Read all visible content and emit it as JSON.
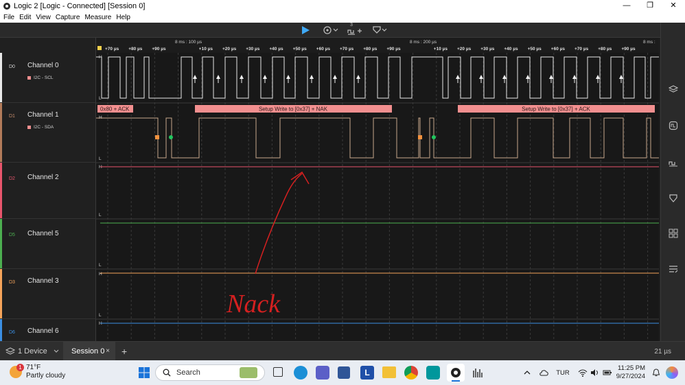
{
  "window": {
    "title": "Logic 2 [Logic - Connected] [Session 0]",
    "minimize": "—",
    "maximize": "❐",
    "close": "✕"
  },
  "menu": [
    "File",
    "Edit",
    "View",
    "Capture",
    "Measure",
    "Help"
  ],
  "toolbar": {
    "play_icon": "play-icon",
    "trigger_icon": "trigger-icon",
    "measure_label": "3",
    "marker_icon": "marker-icon"
  },
  "timeline": {
    "row1": [
      "+70 µs",
      "+80 µs",
      "+90 µs",
      "+10 µs",
      "+20 µs",
      "+30 µs",
      "+40 µs",
      "+50 µs",
      "+60 µs",
      "+70 µs",
      "+80 µs",
      "+90 µs",
      "+10 µs",
      "+20 µs",
      "+30 µs",
      "+40 µs",
      "+50 µs",
      "+60 µs",
      "+70 µs",
      "+80 µs",
      "+90 µs"
    ],
    "markers": [
      "8 ms : 100 µs",
      "8 ms : 200 µs",
      "8 ms :"
    ]
  },
  "channels": [
    {
      "id": "D0",
      "name": "Channel 0",
      "analyzer": "I2C - SCL",
      "color": "#e8e8e8"
    },
    {
      "id": "D1",
      "name": "Channel 1",
      "analyzer": "I2C - SDA",
      "color": "#b27b5a"
    },
    {
      "id": "D2",
      "name": "Channel 2",
      "color": "#e8556c"
    },
    {
      "id": "D5",
      "name": "Channel 5",
      "color": "#4caf50"
    },
    {
      "id": "D3",
      "name": "Channel 3",
      "color": "#f5a45a"
    },
    {
      "id": "D6",
      "name": "Channel 6",
      "color": "#3b8fe3"
    }
  ],
  "levels": {
    "high": "H",
    "low": "L"
  },
  "decodes": [
    {
      "text": "0x80 + ACK"
    },
    {
      "text": "Setup Write to [0x37] + NAK"
    },
    {
      "text": "Setup Write to [0x37] + ACK"
    }
  ],
  "annotation": {
    "text": "Nack",
    "color": "#d42020"
  },
  "session": {
    "device": "1 Device",
    "tab": "Session 0",
    "close": "×",
    "add": "+",
    "zoom": "21 µs"
  },
  "taskbar": {
    "temp": "71°F",
    "weather": "Partly cloudy",
    "weather_badge": "1",
    "search": "Search",
    "lang": "TUR",
    "time": "11:25 PM",
    "date": "9/27/2024"
  }
}
